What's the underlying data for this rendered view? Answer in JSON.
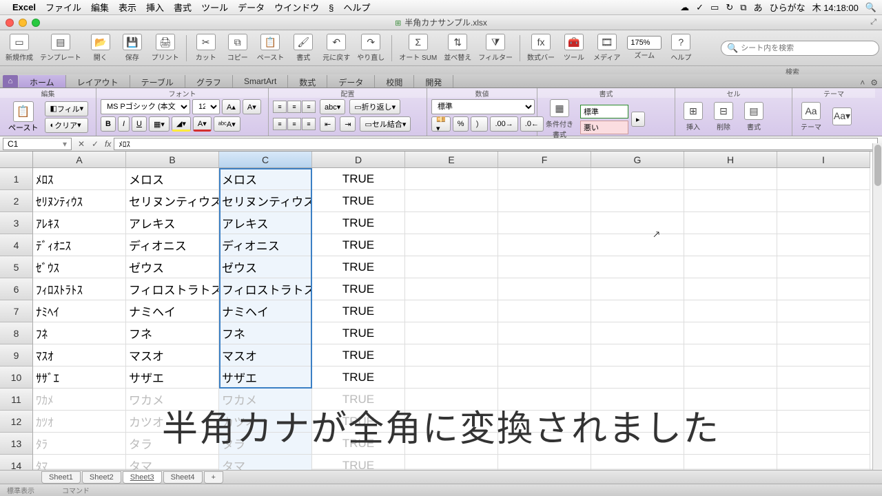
{
  "menubar": {
    "app": "Excel",
    "items": [
      "ファイル",
      "編集",
      "表示",
      "挿入",
      "書式",
      "ツール",
      "データ",
      "ウインドウ",
      "",
      "ヘルプ"
    ],
    "script_icon": "§",
    "ime": "ひらがな",
    "clock": "木 14:18:00"
  },
  "window": {
    "title": "半角カナサンプル.xlsx"
  },
  "toolbar": {
    "items": [
      "新規作成",
      "テンプレート",
      "開く",
      "保存",
      "プリント",
      "",
      "カット",
      "コピー",
      "ペースト",
      "書式",
      "元に戻す",
      "やり直し",
      "",
      "オート SUM",
      "並べ替え",
      "フィルター",
      "",
      "数式バー",
      "ツール",
      "メディア"
    ],
    "zoom_label": "ズーム",
    "zoom_value": "175%",
    "help_label": "ヘルプ",
    "search_placeholder": "シート内を検索",
    "search_sub": "検索"
  },
  "ribbon": {
    "tabs": [
      "ホーム",
      "レイアウト",
      "テーブル",
      "グラフ",
      "SmartArt",
      "数式",
      "データ",
      "校閲",
      "開発"
    ],
    "active": 0,
    "groups": {
      "edit": "編集",
      "font": "フォント",
      "align": "配置",
      "number": "数値",
      "format": "書式",
      "cell": "セル",
      "theme": "テーマ"
    },
    "paste": "ペースト",
    "fill": "フィル",
    "clear": "クリア",
    "font_name": "MS Pゴシック (本文)",
    "font_size": "12",
    "wrap": "折り返し",
    "merge": "セル結合",
    "num_format": "標準",
    "cond_format": "条件付き\n書式",
    "style_std": "標準",
    "style_bad": "悪い",
    "insert": "挿入",
    "delete": "削除",
    "fmt": "書式",
    "themes": "テーマ"
  },
  "formula": {
    "cell_ref": "C1",
    "content": "ﾒﾛｽ"
  },
  "grid": {
    "cols": [
      "A",
      "B",
      "C",
      "D",
      "E",
      "F",
      "G",
      "H",
      "I"
    ],
    "selected_col": 2,
    "rows": [
      {
        "n": 1,
        "a": "ﾒﾛｽ",
        "b": "メロス",
        "c": "メロス",
        "d": "TRUE"
      },
      {
        "n": 2,
        "a": "ｾﾘﾇﾝﾃｨｳｽ",
        "b": "セリヌンティウス",
        "c": "セリヌンティウス",
        "d": "TRUE"
      },
      {
        "n": 3,
        "a": "ｱﾚｷｽ",
        "b": "アレキス",
        "c": "アレキス",
        "d": "TRUE"
      },
      {
        "n": 4,
        "a": "ﾃﾞｨｵﾆｽ",
        "b": "ディオニス",
        "c": "ディオニス",
        "d": "TRUE"
      },
      {
        "n": 5,
        "a": "ｾﾞｳｽ",
        "b": "ゼウス",
        "c": "ゼウス",
        "d": "TRUE"
      },
      {
        "n": 6,
        "a": "ﾌｨﾛｽﾄﾗﾄｽ",
        "b": "フィロストラトス",
        "c": "フィロストラトス",
        "d": "TRUE"
      },
      {
        "n": 7,
        "a": "ﾅﾐﾍｲ",
        "b": "ナミヘイ",
        "c": "ナミヘイ",
        "d": "TRUE"
      },
      {
        "n": 8,
        "a": "ﾌﾈ",
        "b": "フネ",
        "c": "フネ",
        "d": "TRUE"
      },
      {
        "n": 9,
        "a": "ﾏｽｵ",
        "b": "マスオ",
        "c": "マスオ",
        "d": "TRUE"
      },
      {
        "n": 10,
        "a": "ｻｻﾞｴ",
        "b": "サザエ",
        "c": "サザエ",
        "d": "TRUE"
      },
      {
        "n": 11,
        "a": "ﾜｶﾒ",
        "b": "ワカメ",
        "c": "ワカメ",
        "d": "TRUE",
        "faded": true
      },
      {
        "n": 12,
        "a": "ｶﾂｵ",
        "b": "カツオ",
        "c": "カツオ",
        "d": "TRUE",
        "faded": true
      },
      {
        "n": 13,
        "a": "ﾀﾗ",
        "b": "タラ",
        "c": "タラ",
        "d": "TRUE",
        "faded": true
      },
      {
        "n": 14,
        "a": "ﾀﾏ",
        "b": "タマ",
        "c": "タマ",
        "d": "TRUE",
        "faded": true
      }
    ]
  },
  "overlay": "半角カナが全角に変換されました",
  "sheets": {
    "tabs": [
      "Sheet1",
      "Sheet2",
      "Sheet3",
      "Sheet4",
      "+"
    ],
    "active": 2
  },
  "status": {
    "mode": "標準表示",
    "cmd": "コマンド"
  }
}
